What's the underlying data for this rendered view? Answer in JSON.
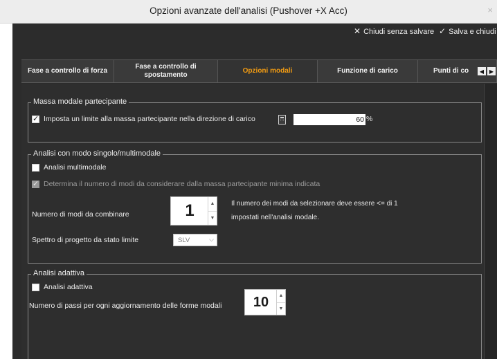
{
  "window": {
    "title": "Opzioni avanzate dell'analisi (Pushover +X Acc)",
    "close_glyph": "×"
  },
  "actions": {
    "close_without_saving": "Chiudi senza salvare",
    "save_and_close": "Salva e chiudi"
  },
  "tabs": [
    {
      "label": "Fase a controllo di forza",
      "active": false
    },
    {
      "label": "Fase a controllo di spostamento",
      "active": false
    },
    {
      "label": "Opzioni modali",
      "active": true
    },
    {
      "label": "Funzione di carico",
      "active": false
    },
    {
      "label": "Punti di co",
      "active": false
    }
  ],
  "modal_mass": {
    "legend": "Massa modale partecipante",
    "limit_checkbox_label": "Imposta un limite alla massa partecipante nella direzione di carico",
    "limit_checked": true,
    "limit_value": "60",
    "limit_unit": "%"
  },
  "single_multimodal": {
    "legend": "Analisi con modo singolo/multimodale",
    "multimodal_label": "Analisi multimodale",
    "multimodal_checked": false,
    "determine_modes_label": "Determina il numero di modi da considerare dalla massa partecipante minima indicata",
    "determine_modes_checked": true,
    "determine_modes_disabled": true,
    "modes_to_combine_label": "Numero di modi da combinare",
    "modes_to_combine_value": "1",
    "info_line1": "Il numero dei modi da selezionare deve essere <= di 1",
    "info_line2": "impostati nell'analisi modale.",
    "spectrum_label": "Spettro di progetto da stato limite",
    "spectrum_value": "SLV"
  },
  "adaptive": {
    "legend": "Analisi adattiva",
    "adaptive_label": "Analisi adattiva",
    "adaptive_checked": false,
    "steps_label": "Numero di passi per ogni aggiornamento delle forme modali",
    "steps_value": "10"
  },
  "colors": {
    "accent": "#f39c12",
    "background": "#2e2e2e",
    "titlebar": "#ededed"
  }
}
